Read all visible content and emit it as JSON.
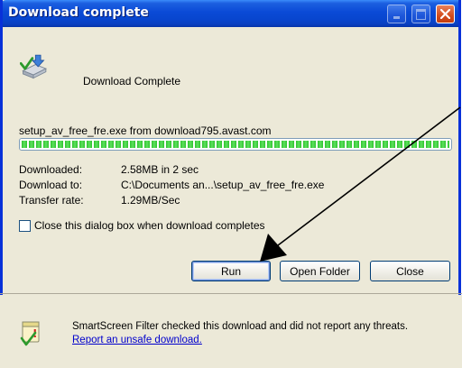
{
  "window": {
    "title": "Download complete",
    "controls": {
      "minimize": "minimize",
      "maximize": "maximize",
      "close": "close"
    }
  },
  "status_heading": "Download Complete",
  "file_line": "setup_av_free_fre.exe from download795.avast.com",
  "progress": {
    "percent": 100
  },
  "info": [
    {
      "label": "Downloaded:",
      "value": "2.58MB in 2 sec"
    },
    {
      "label": "Download to:",
      "value": "C:\\Documents an...\\setup_av_free_fre.exe"
    },
    {
      "label": "Transfer rate:",
      "value": "1.29MB/Sec"
    }
  ],
  "checkbox": {
    "label": "Close this dialog box when download completes",
    "checked": false
  },
  "buttons": {
    "run": "Run",
    "open_folder": "Open Folder",
    "close": "Close"
  },
  "footer": {
    "text": "SmartScreen Filter checked this download and did not report any threats.",
    "link": "Report an unsafe download."
  },
  "icons": {
    "download": "download-icon",
    "shield": "smartscreen-shield-icon",
    "arrow": "annotation-arrow"
  },
  "colors": {
    "title_bar": "#0a4ad6",
    "progress": "#2ec32e",
    "link": "#0000cc",
    "arrow": "#000000"
  }
}
